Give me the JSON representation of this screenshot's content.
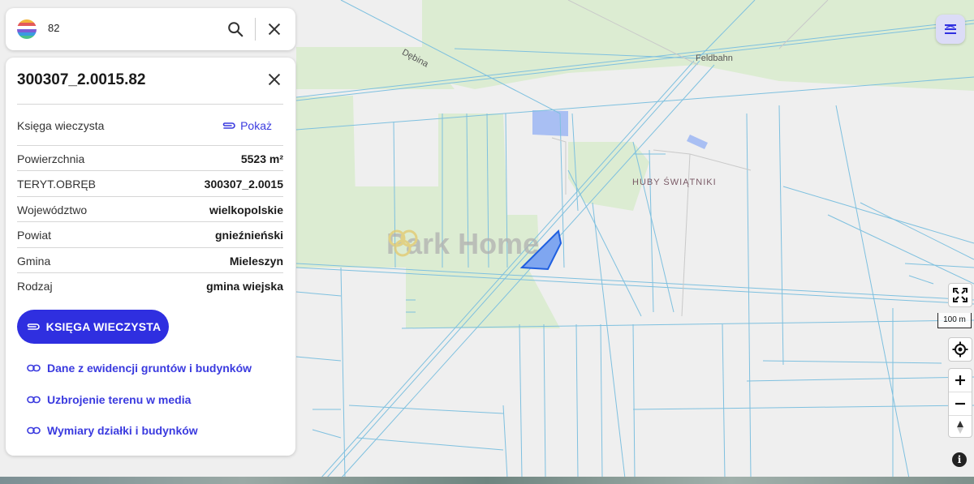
{
  "search": {
    "value": "82"
  },
  "parcel": {
    "title": "300307_2.0015.82",
    "rows": [
      {
        "label": "Księga wieczysta",
        "link": "Pokaż"
      },
      {
        "label": "Powierzchnia",
        "value": "5523 m²"
      },
      {
        "label": "TERYT.OBRĘB",
        "value": "300307_2.0015"
      },
      {
        "label": "Województwo",
        "value": "wielkopolskie"
      },
      {
        "label": "Powiat",
        "value": "gnieźnieński"
      },
      {
        "label": "Gmina",
        "value": "Mieleszyn"
      },
      {
        "label": "Rodzaj",
        "value": "gmina wiejska"
      }
    ],
    "cta": "KSIĘGA WIECZYSTA",
    "links": [
      "Dane z ewidencji gruntów i budynków",
      "Uzbrojenie terenu w media",
      "Wymiary działki i budynków"
    ]
  },
  "map": {
    "place_label": "HUBY ŚWIĄTNIKI",
    "road_labels": [
      "Dębina",
      "Feldbahn"
    ],
    "watermark": "Park Home",
    "scale": "100 m",
    "parcel_fill": "#7fa6f0",
    "parcel_stroke": "#1f5fe0",
    "line_color": "#7ec0df",
    "forest_color": "#dcecd2",
    "water_color": "#a9bff3"
  },
  "controls": {
    "info": "i"
  },
  "colors": {
    "accent": "#2f2fe0",
    "link": "#3a3adf"
  }
}
